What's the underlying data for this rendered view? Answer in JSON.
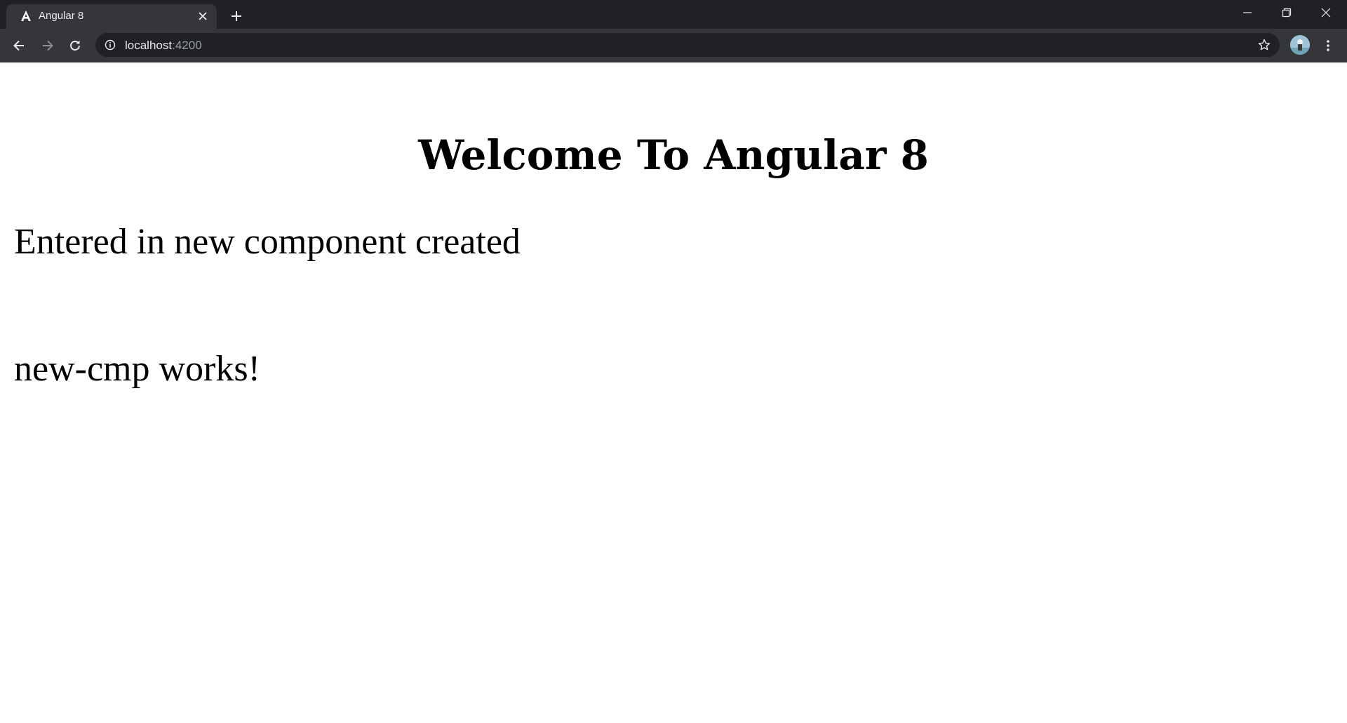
{
  "browser": {
    "tab": {
      "title": "Angular 8",
      "favicon": "angular-logo-icon"
    },
    "address": {
      "host": "localhost",
      "port": ":4200"
    },
    "theme": {
      "frame": "#202124",
      "toolbar": "#35363a",
      "text": "#e8eaed",
      "muted": "#9aa0a6"
    }
  },
  "page": {
    "heading": "Welcome To Angular 8",
    "paragraphs": [
      "Entered in new component created",
      "new-cmp works!"
    ]
  }
}
